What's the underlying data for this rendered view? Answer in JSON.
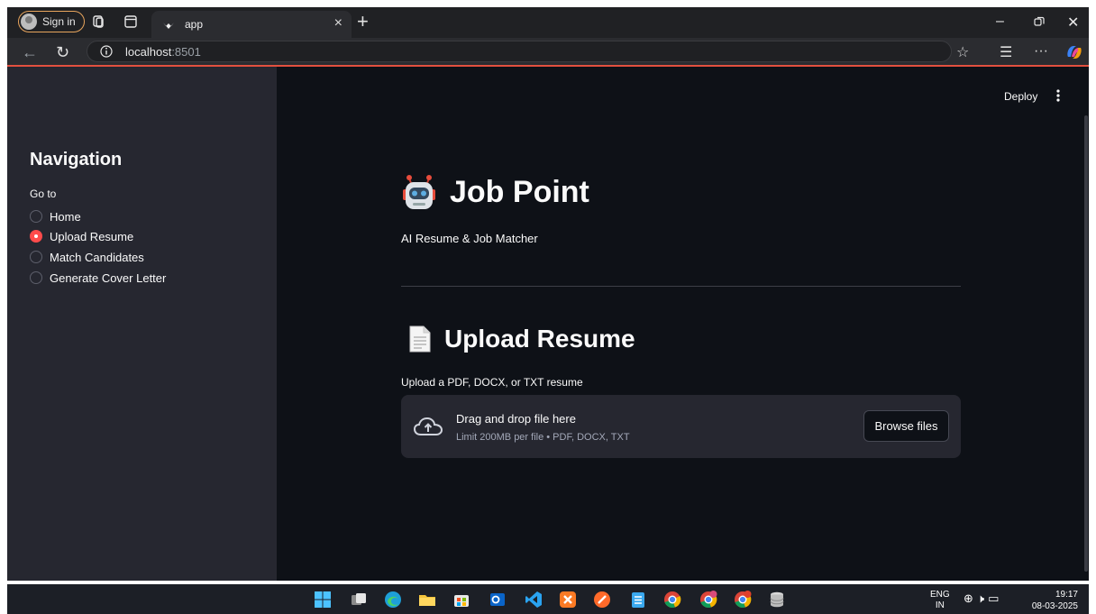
{
  "browser": {
    "sign_in": "Sign in",
    "tab_title": "app",
    "url_host": "localhost",
    "url_port": ":8501"
  },
  "header": {
    "deploy": "Deploy"
  },
  "sidebar": {
    "title": "Navigation",
    "goto_label": "Go to",
    "options": [
      {
        "label": "Home",
        "selected": false
      },
      {
        "label": "Upload Resume",
        "selected": true
      },
      {
        "label": "Match Candidates",
        "selected": false
      },
      {
        "label": "Generate Cover Letter",
        "selected": false
      }
    ]
  },
  "main": {
    "title": "Job Point",
    "tagline": "AI Resume & Job Matcher",
    "section_title": "Upload Resume",
    "upload_label": "Upload a PDF, DOCX, or TXT resume",
    "dropzone": {
      "main_text": "Drag and drop file here",
      "sub_text": "Limit 200MB per file • PDF, DOCX, TXT",
      "browse_button": "Browse files"
    }
  },
  "taskbar": {
    "lang_line1": "ENG",
    "lang_line2": "IN",
    "time": "19:17",
    "date": "08-03-2025"
  },
  "colors": {
    "accent": "#ff4b4b",
    "app_bg": "#0e1117",
    "sidebar_bg": "#262730"
  }
}
